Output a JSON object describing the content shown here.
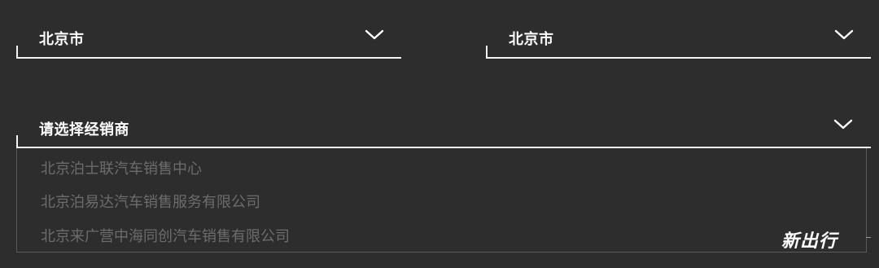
{
  "province_select": {
    "value": "北京市",
    "icon": "chevron-down-icon"
  },
  "city_select": {
    "value": "北京市",
    "icon": "chevron-down-icon"
  },
  "dealer_select": {
    "placeholder": "请选择经销商",
    "icon": "chevron-down-icon",
    "options": [
      "北京泊士联汽车销售中心",
      "北京泊易达汽车销售服务有限公司",
      "北京来广营中海同创汽车销售有限公司"
    ]
  },
  "watermark": {
    "text": "新出行"
  },
  "colors": {
    "background": "#2d2d2d",
    "text": "#ffffff",
    "underline": "#f2f2f2",
    "option_text": "#6c6c6c",
    "list_border": "#5a5a5a"
  }
}
